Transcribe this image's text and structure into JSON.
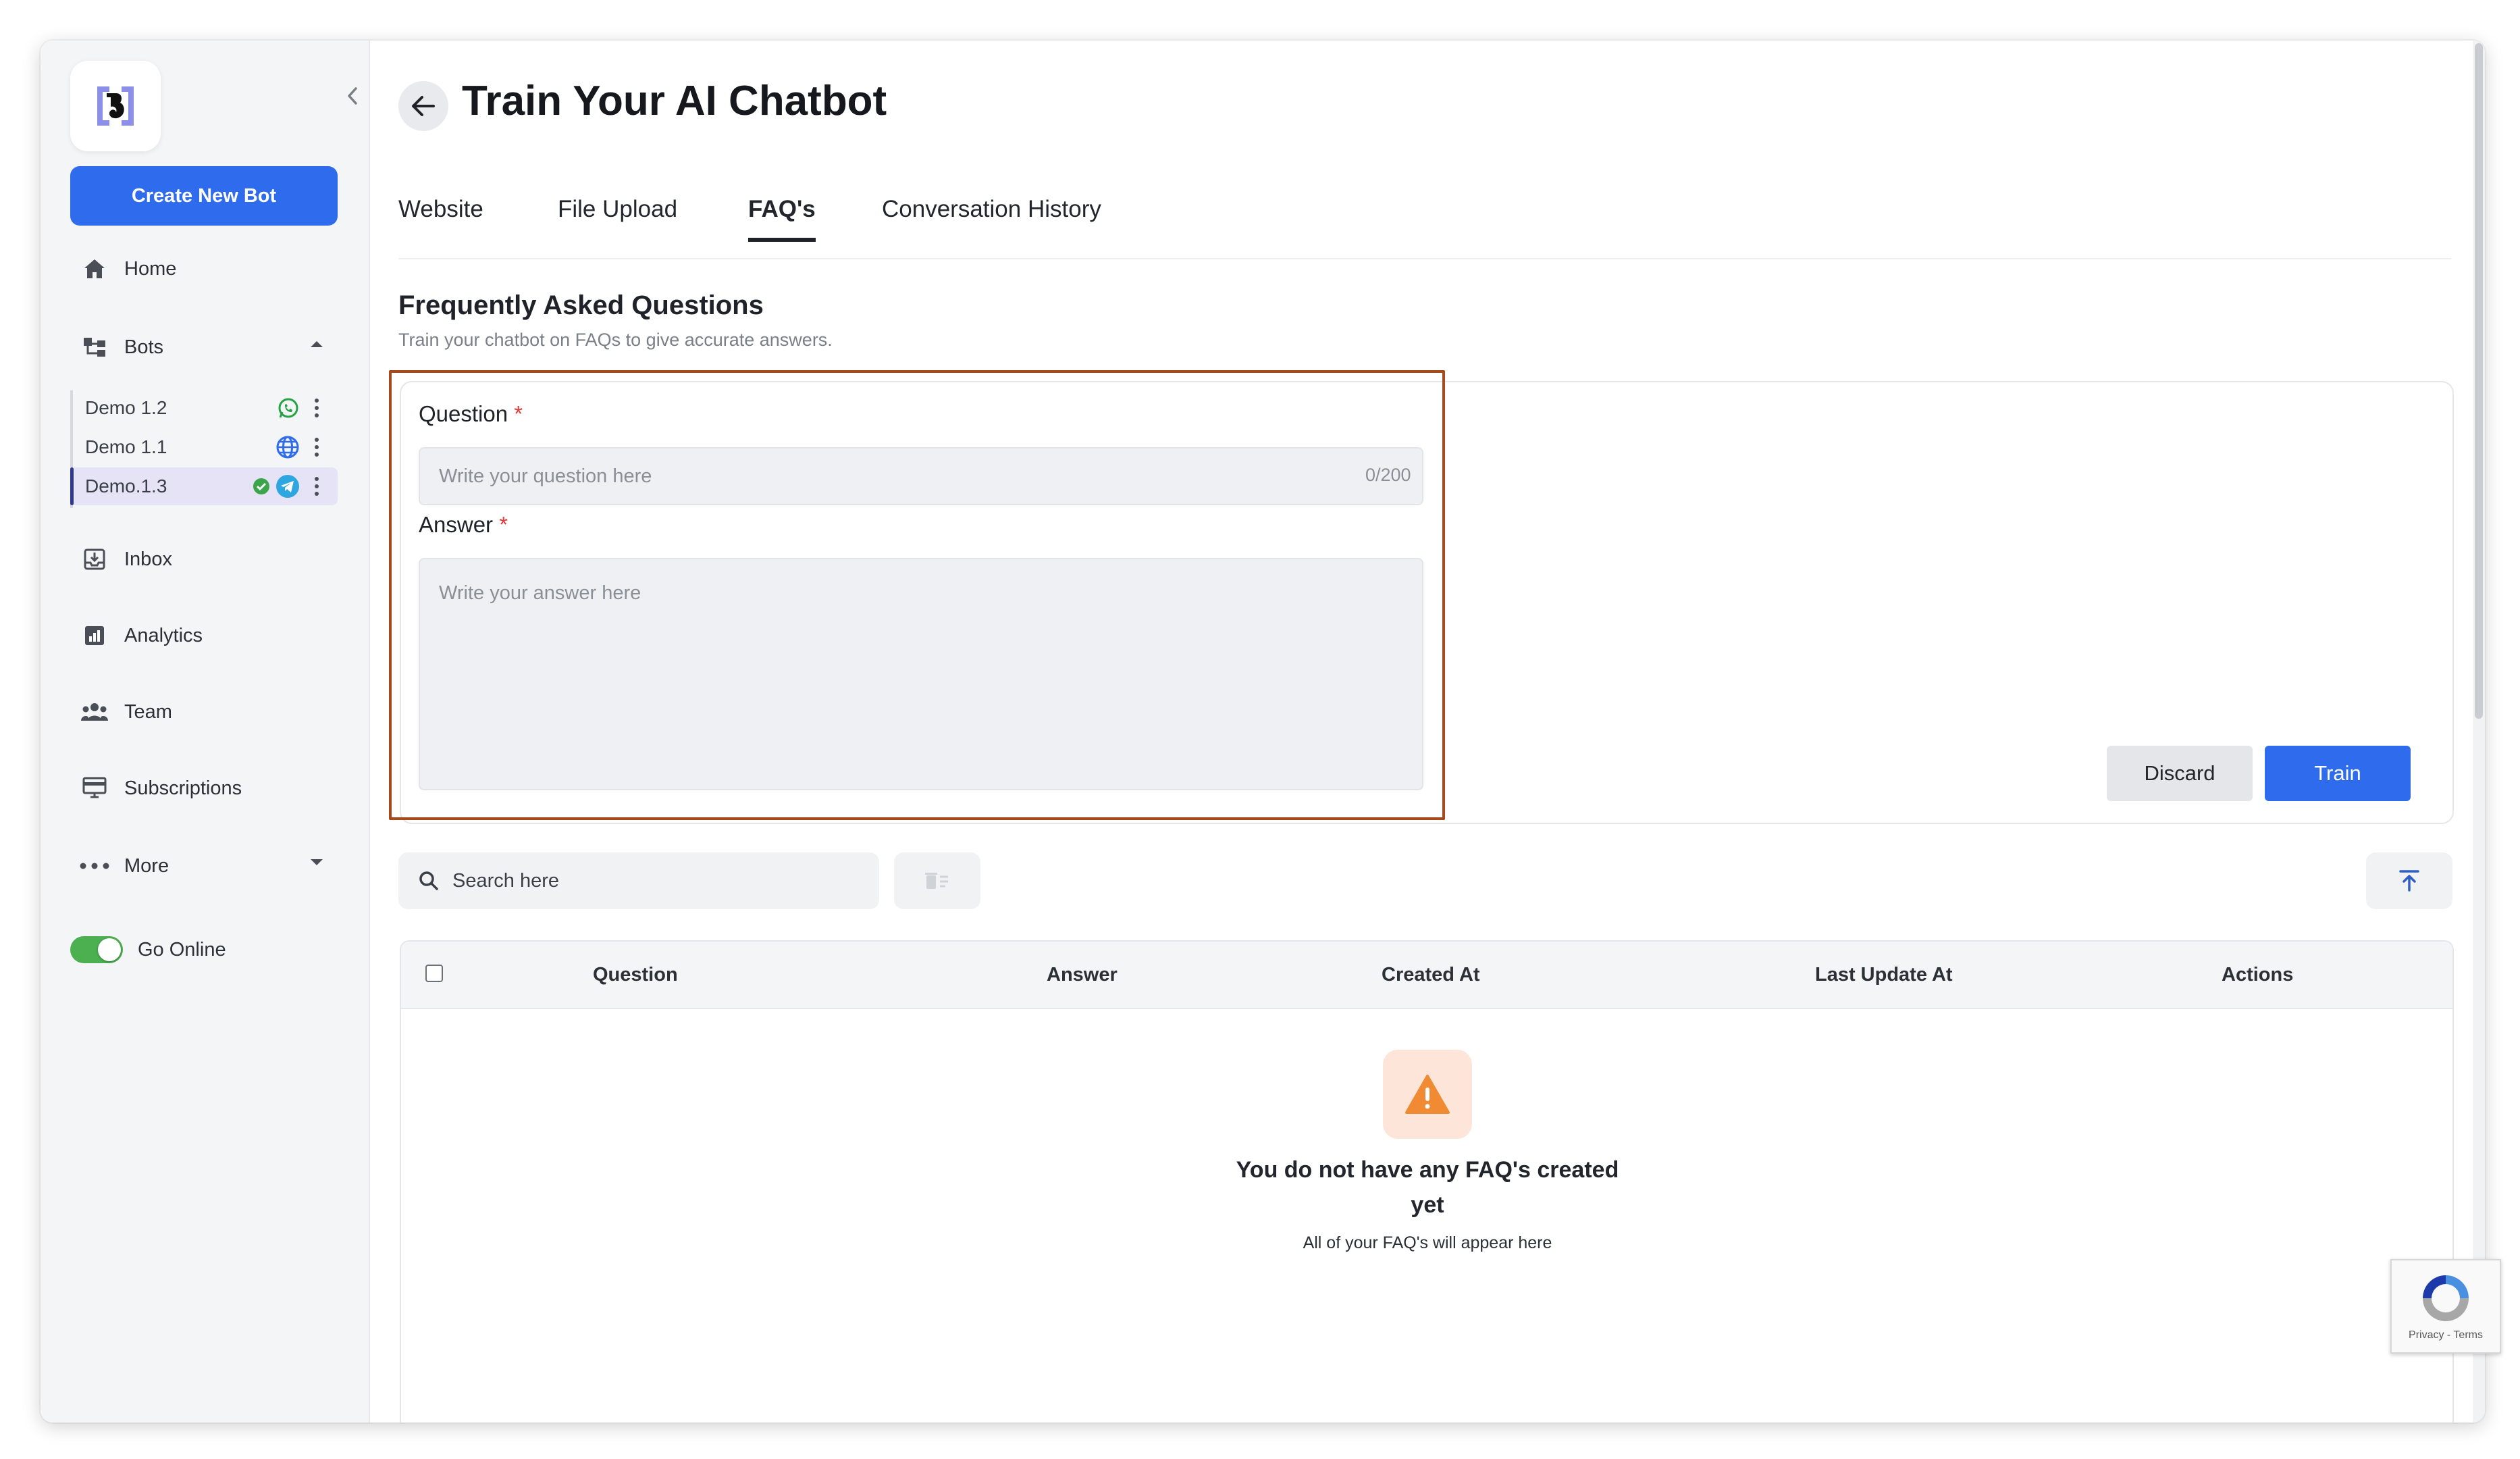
{
  "sidebar": {
    "create_label": "Create New Bot",
    "nav": {
      "home": "Home",
      "bots": "Bots",
      "inbox": "Inbox",
      "analytics": "Analytics",
      "team": "Team",
      "subscriptions": "Subscriptions",
      "more": "More"
    },
    "bots": [
      {
        "name": "Demo 1.2",
        "channel": "whatsapp-icon"
      },
      {
        "name": "Demo 1.1",
        "channel": "globe-icon"
      },
      {
        "name": "Demo.1.3",
        "channel": "telegram-icon",
        "active": true
      }
    ],
    "toggle_label": "Go Online"
  },
  "header": {
    "title": "Train Your AI Chatbot",
    "tabs": [
      "Website",
      "File Upload",
      "FAQ's",
      "Conversation History"
    ],
    "active_tab": "FAQ's"
  },
  "section": {
    "title": "Frequently Asked Questions",
    "subtitle": "Train your chatbot on FAQs to give accurate answers."
  },
  "form": {
    "question_label": "Question",
    "question_placeholder": "Write your question here",
    "question_counter": "0/200",
    "answer_label": "Answer",
    "answer_placeholder": "Write your answer here",
    "required_mark": "*",
    "discard_label": "Discard",
    "train_label": "Train"
  },
  "search": {
    "placeholder": "Search here"
  },
  "table": {
    "columns": [
      "Question",
      "Answer",
      "Created At",
      "Last Update At",
      "Actions"
    ],
    "rows": [],
    "empty_title": "You do not have any FAQ's created yet",
    "empty_subtitle": "All of your FAQ's will appear here"
  },
  "recaptcha": {
    "text": "Privacy - Terms"
  },
  "colors": {
    "accent": "#2f6bed",
    "highlight_border": "#a44a1c",
    "warning": "#f08a33",
    "online": "#4caf50"
  }
}
